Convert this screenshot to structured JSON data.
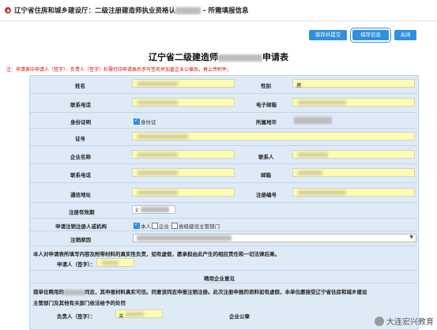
{
  "page": {
    "title_prefix": "辽宁省住房和城乡建设厅：二级注册建造师执业资格认",
    "title_suffix": " - 所需填报信息",
    "buttons": {
      "save_submit": "保存并提交",
      "save": "保存信息",
      "close": "关闭"
    },
    "form_title_prefix": "辽宁省二级建造师",
    "form_title_suffix": "申请表",
    "notice": "注：申请表中申请人（签字）、负责人（签字）栏需打印申请表后手写签名并加盖企业公章后，再上传附件。"
  },
  "form": {
    "name_label": "姓名",
    "gender_label": "性别",
    "gender_value": "男",
    "phone_label": "联系电话",
    "email_label": "电子邮箱",
    "id_label": "身份证明",
    "id_checkbox": "身份证",
    "region_label": "所属地市",
    "cert_label": "证号",
    "company_label": "企业名称",
    "contact_label": "联系人",
    "company_phone_label": "联系电话",
    "postcode_label": "邮箱",
    "address_label": "通信地址",
    "reg_no_label": "注册编号",
    "reg_valid_label": "注册有效期",
    "reg_valid_value": "2",
    "applicant_org_label": "申请注销注册人或机构",
    "org_options": [
      "本人",
      "企业",
      "省级建设主管部门"
    ],
    "cancel_reason_label": "注销原因",
    "declaration": "本人对申请表所填写内容及附带材料的真实性负责，如有虚假，愿承担由此产生的相应责任和一切法律后果。",
    "applicant_sign_label": "申请人（签字）：",
    "employer_opinion_label": "聘用企业意见",
    "employer_statement_1": "我单位聘用的",
    "employer_statement_2": "同志，其申报材料真实可信。同意该同志申报注销注册。此次注册申报的资料如有虚假，本单位愿接受辽宁省住房和城乡建设",
    "employer_statement_3": "主管部门及其他有关部门依法给予的处罚",
    "leader_sign_label": "负责人（签字）：",
    "leader_sign_value": "关",
    "company_seal_label": "企业公章"
  },
  "watermark": "大连宏兴教育"
}
